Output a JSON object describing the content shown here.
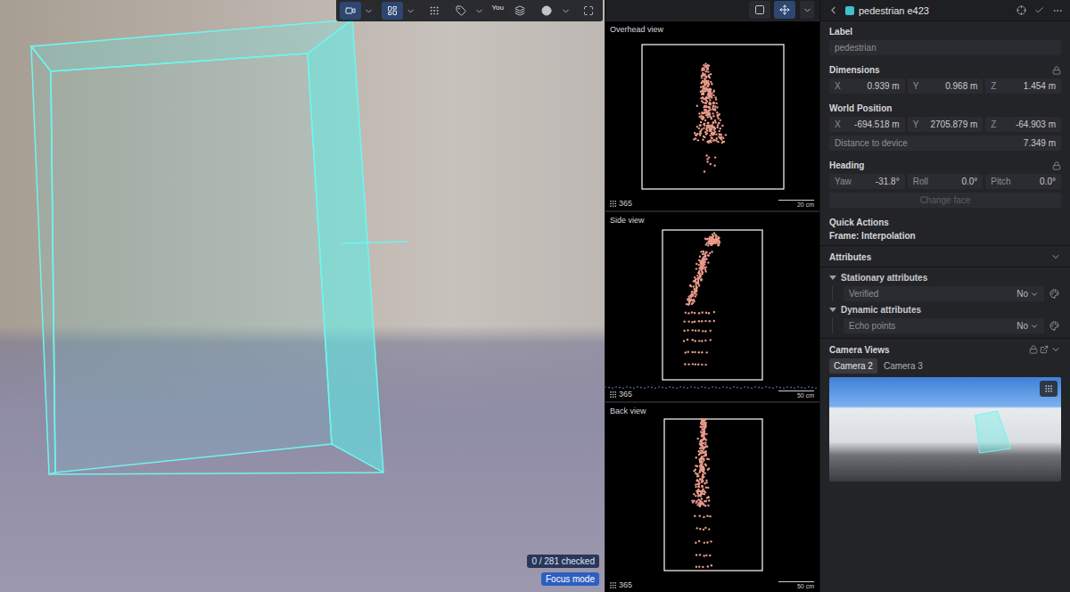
{
  "camera_view": {
    "toolbar": [
      {
        "selected": true,
        "dropdown": true
      },
      {
        "selected": true,
        "dropdown": true
      },
      {
        "selected": false,
        "dropdown": false
      },
      {
        "selected": false,
        "dropdown": true
      },
      {
        "selected": false,
        "dropdown": false
      },
      {
        "selected": false,
        "dropdown": true
      },
      {
        "selected": false,
        "dropdown": false
      }
    ],
    "user_label": "You",
    "checked_badge": "0 / 281 checked",
    "focus_mode": "Focus mode"
  },
  "views_toolbar": [
    {
      "selected": false
    },
    {
      "selected": true
    }
  ],
  "views": [
    {
      "title": "Overhead view",
      "count": "365",
      "scale": "20 cm"
    },
    {
      "title": "Side view",
      "count": "365",
      "scale": "50 cm"
    },
    {
      "title": "Back view",
      "count": "365",
      "scale": "50 cm"
    }
  ],
  "inspector": {
    "title": "pedestrian e423",
    "color": "#3fc1c9",
    "label": {
      "title": "Label",
      "value": "pedestrian"
    },
    "dimensions": {
      "title": "Dimensions",
      "locked": true,
      "fields": [
        {
          "axis": "X",
          "value": "0.939 m"
        },
        {
          "axis": "Y",
          "value": "0.968 m"
        },
        {
          "axis": "Z",
          "value": "1.454 m"
        }
      ]
    },
    "world_position": {
      "title": "World Position",
      "locked": false,
      "fields": [
        {
          "axis": "X",
          "value": "-694.518 m"
        },
        {
          "axis": "Y",
          "value": "2705.879 m"
        },
        {
          "axis": "Z",
          "value": "-64.903 m"
        }
      ],
      "distance": {
        "label": "Distance to device",
        "value": "7.349 m"
      }
    },
    "heading": {
      "title": "Heading",
      "locked": true,
      "fields": [
        {
          "axis": "Yaw",
          "value": "-31.8°"
        },
        {
          "axis": "Roll",
          "value": "0.0°"
        },
        {
          "axis": "Pitch",
          "value": "0.0°"
        }
      ],
      "button": {
        "label": "Change face",
        "disabled": true
      }
    },
    "quick_actions": {
      "title": "Quick Actions",
      "frame": "Frame: Interpolation"
    },
    "attributes": {
      "title": "Attributes",
      "expanded": true,
      "groups": [
        {
          "title": "Stationary attributes",
          "expanded": true,
          "items": [
            {
              "label": "Verified",
              "value": "No"
            }
          ]
        },
        {
          "title": "Dynamic attributes",
          "expanded": true,
          "items": [
            {
              "label": "Echo points",
              "value": "No"
            }
          ]
        }
      ]
    },
    "camera_views": {
      "title": "Camera Views",
      "locked": true,
      "expanded": true,
      "tabs": [
        {
          "label": "Camera 2",
          "selected": true
        },
        {
          "label": "Camera 3",
          "selected": false
        }
      ]
    }
  }
}
